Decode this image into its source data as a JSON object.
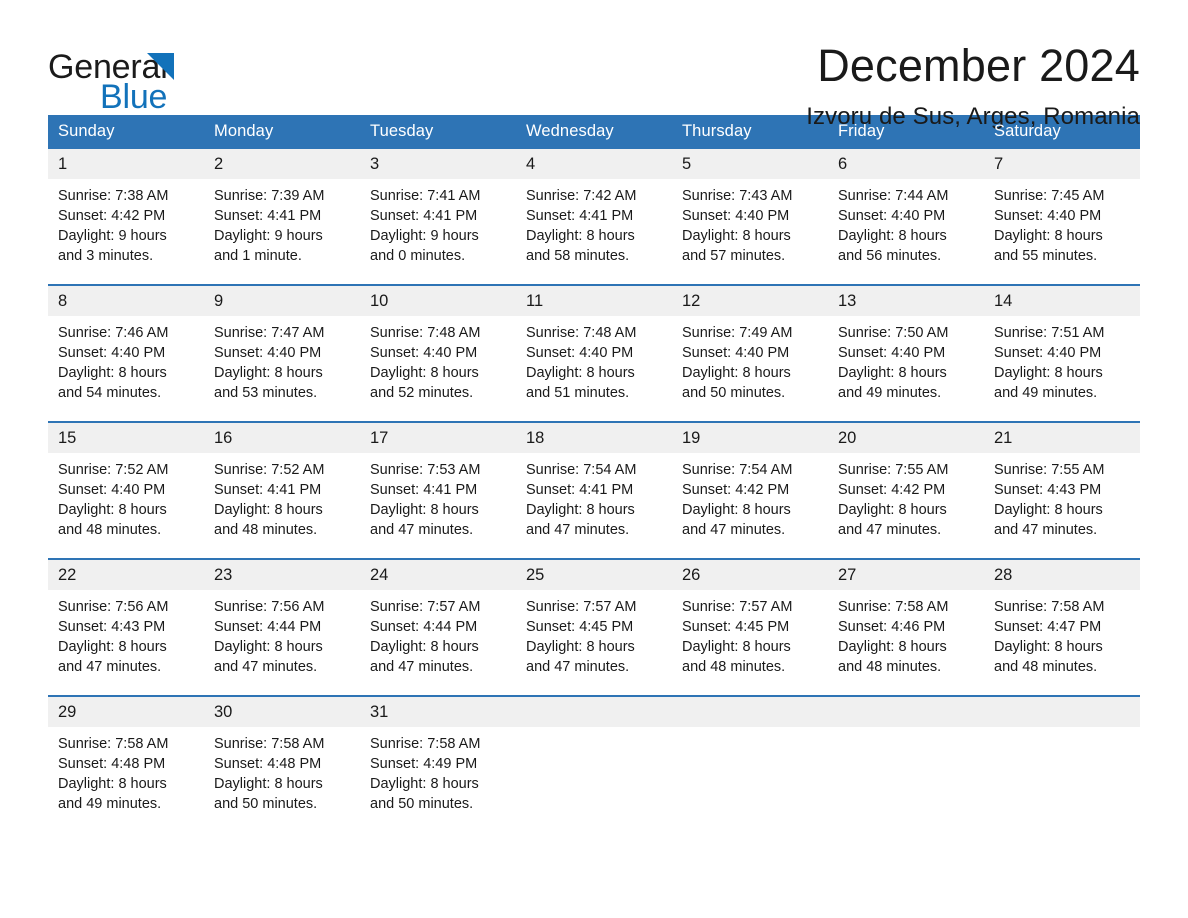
{
  "brand": {
    "name_part1": "General",
    "name_part2": "Blue",
    "triangle_icon": "triangle-icon",
    "accent_color": "#1272ba"
  },
  "header": {
    "title": "December 2024",
    "subtitle": "Izvoru de Sus, Arges, Romania"
  },
  "calendar": {
    "header_color": "#2e74b5",
    "daynum_band_color": "#f0f0f0",
    "weekday_headers": [
      "Sunday",
      "Monday",
      "Tuesday",
      "Wednesday",
      "Thursday",
      "Friday",
      "Saturday"
    ],
    "weeks": [
      [
        {
          "day": "1",
          "sunrise": "Sunrise: 7:38 AM",
          "sunset": "Sunset: 4:42 PM",
          "daylight": "Daylight: 9 hours\nand 3 minutes."
        },
        {
          "day": "2",
          "sunrise": "Sunrise: 7:39 AM",
          "sunset": "Sunset: 4:41 PM",
          "daylight": "Daylight: 9 hours\nand 1 minute."
        },
        {
          "day": "3",
          "sunrise": "Sunrise: 7:41 AM",
          "sunset": "Sunset: 4:41 PM",
          "daylight": "Daylight: 9 hours\nand 0 minutes."
        },
        {
          "day": "4",
          "sunrise": "Sunrise: 7:42 AM",
          "sunset": "Sunset: 4:41 PM",
          "daylight": "Daylight: 8 hours\nand 58 minutes."
        },
        {
          "day": "5",
          "sunrise": "Sunrise: 7:43 AM",
          "sunset": "Sunset: 4:40 PM",
          "daylight": "Daylight: 8 hours\nand 57 minutes."
        },
        {
          "day": "6",
          "sunrise": "Sunrise: 7:44 AM",
          "sunset": "Sunset: 4:40 PM",
          "daylight": "Daylight: 8 hours\nand 56 minutes."
        },
        {
          "day": "7",
          "sunrise": "Sunrise: 7:45 AM",
          "sunset": "Sunset: 4:40 PM",
          "daylight": "Daylight: 8 hours\nand 55 minutes."
        }
      ],
      [
        {
          "day": "8",
          "sunrise": "Sunrise: 7:46 AM",
          "sunset": "Sunset: 4:40 PM",
          "daylight": "Daylight: 8 hours\nand 54 minutes."
        },
        {
          "day": "9",
          "sunrise": "Sunrise: 7:47 AM",
          "sunset": "Sunset: 4:40 PM",
          "daylight": "Daylight: 8 hours\nand 53 minutes."
        },
        {
          "day": "10",
          "sunrise": "Sunrise: 7:48 AM",
          "sunset": "Sunset: 4:40 PM",
          "daylight": "Daylight: 8 hours\nand 52 minutes."
        },
        {
          "day": "11",
          "sunrise": "Sunrise: 7:48 AM",
          "sunset": "Sunset: 4:40 PM",
          "daylight": "Daylight: 8 hours\nand 51 minutes."
        },
        {
          "day": "12",
          "sunrise": "Sunrise: 7:49 AM",
          "sunset": "Sunset: 4:40 PM",
          "daylight": "Daylight: 8 hours\nand 50 minutes."
        },
        {
          "day": "13",
          "sunrise": "Sunrise: 7:50 AM",
          "sunset": "Sunset: 4:40 PM",
          "daylight": "Daylight: 8 hours\nand 49 minutes."
        },
        {
          "day": "14",
          "sunrise": "Sunrise: 7:51 AM",
          "sunset": "Sunset: 4:40 PM",
          "daylight": "Daylight: 8 hours\nand 49 minutes."
        }
      ],
      [
        {
          "day": "15",
          "sunrise": "Sunrise: 7:52 AM",
          "sunset": "Sunset: 4:40 PM",
          "daylight": "Daylight: 8 hours\nand 48 minutes."
        },
        {
          "day": "16",
          "sunrise": "Sunrise: 7:52 AM",
          "sunset": "Sunset: 4:41 PM",
          "daylight": "Daylight: 8 hours\nand 48 minutes."
        },
        {
          "day": "17",
          "sunrise": "Sunrise: 7:53 AM",
          "sunset": "Sunset: 4:41 PM",
          "daylight": "Daylight: 8 hours\nand 47 minutes."
        },
        {
          "day": "18",
          "sunrise": "Sunrise: 7:54 AM",
          "sunset": "Sunset: 4:41 PM",
          "daylight": "Daylight: 8 hours\nand 47 minutes."
        },
        {
          "day": "19",
          "sunrise": "Sunrise: 7:54 AM",
          "sunset": "Sunset: 4:42 PM",
          "daylight": "Daylight: 8 hours\nand 47 minutes."
        },
        {
          "day": "20",
          "sunrise": "Sunrise: 7:55 AM",
          "sunset": "Sunset: 4:42 PM",
          "daylight": "Daylight: 8 hours\nand 47 minutes."
        },
        {
          "day": "21",
          "sunrise": "Sunrise: 7:55 AM",
          "sunset": "Sunset: 4:43 PM",
          "daylight": "Daylight: 8 hours\nand 47 minutes."
        }
      ],
      [
        {
          "day": "22",
          "sunrise": "Sunrise: 7:56 AM",
          "sunset": "Sunset: 4:43 PM",
          "daylight": "Daylight: 8 hours\nand 47 minutes."
        },
        {
          "day": "23",
          "sunrise": "Sunrise: 7:56 AM",
          "sunset": "Sunset: 4:44 PM",
          "daylight": "Daylight: 8 hours\nand 47 minutes."
        },
        {
          "day": "24",
          "sunrise": "Sunrise: 7:57 AM",
          "sunset": "Sunset: 4:44 PM",
          "daylight": "Daylight: 8 hours\nand 47 minutes."
        },
        {
          "day": "25",
          "sunrise": "Sunrise: 7:57 AM",
          "sunset": "Sunset: 4:45 PM",
          "daylight": "Daylight: 8 hours\nand 47 minutes."
        },
        {
          "day": "26",
          "sunrise": "Sunrise: 7:57 AM",
          "sunset": "Sunset: 4:45 PM",
          "daylight": "Daylight: 8 hours\nand 48 minutes."
        },
        {
          "day": "27",
          "sunrise": "Sunrise: 7:58 AM",
          "sunset": "Sunset: 4:46 PM",
          "daylight": "Daylight: 8 hours\nand 48 minutes."
        },
        {
          "day": "28",
          "sunrise": "Sunrise: 7:58 AM",
          "sunset": "Sunset: 4:47 PM",
          "daylight": "Daylight: 8 hours\nand 48 minutes."
        }
      ],
      [
        {
          "day": "29",
          "sunrise": "Sunrise: 7:58 AM",
          "sunset": "Sunset: 4:48 PM",
          "daylight": "Daylight: 8 hours\nand 49 minutes."
        },
        {
          "day": "30",
          "sunrise": "Sunrise: 7:58 AM",
          "sunset": "Sunset: 4:48 PM",
          "daylight": "Daylight: 8 hours\nand 50 minutes."
        },
        {
          "day": "31",
          "sunrise": "Sunrise: 7:58 AM",
          "sunset": "Sunset: 4:49 PM",
          "daylight": "Daylight: 8 hours\nand 50 minutes."
        },
        {
          "day": "",
          "sunrise": "",
          "sunset": "",
          "daylight": ""
        },
        {
          "day": "",
          "sunrise": "",
          "sunset": "",
          "daylight": ""
        },
        {
          "day": "",
          "sunrise": "",
          "sunset": "",
          "daylight": ""
        },
        {
          "day": "",
          "sunrise": "",
          "sunset": "",
          "daylight": ""
        }
      ]
    ]
  }
}
